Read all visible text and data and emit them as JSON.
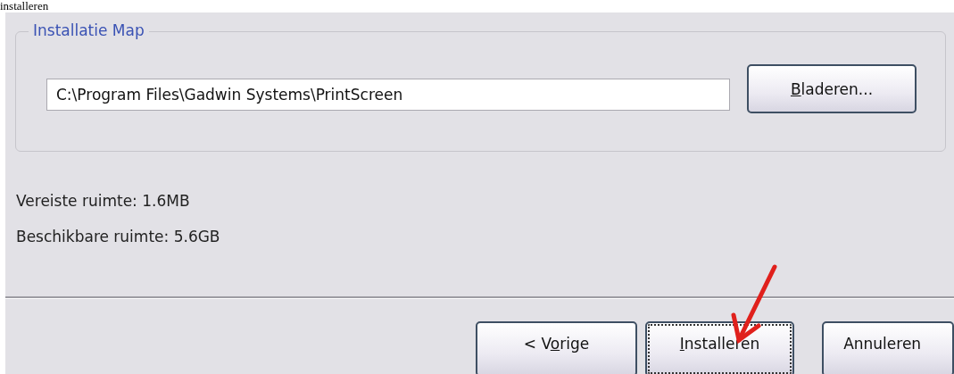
{
  "heading": "installeren",
  "install_folder": {
    "legend": "Installatie Map",
    "path": "C:\\Program Files\\Gadwin Systems\\PrintScreen",
    "browse_button": {
      "access_key": "B",
      "label_end": "laderen...",
      "focused": false
    }
  },
  "space_info": [
    "Vereiste ruimte: 1.6MB",
    "Beschikbare ruimte: 5.6GB"
  ],
  "buttons": [
    {
      "label_start": "< V",
      "access_key": "o",
      "label_end": "rige",
      "focused": false
    },
    {
      "access_key": "I",
      "label_end": "nstalleren",
      "focused": true
    },
    {
      "label_start": "Annuleren",
      "focused": false
    }
  ]
}
